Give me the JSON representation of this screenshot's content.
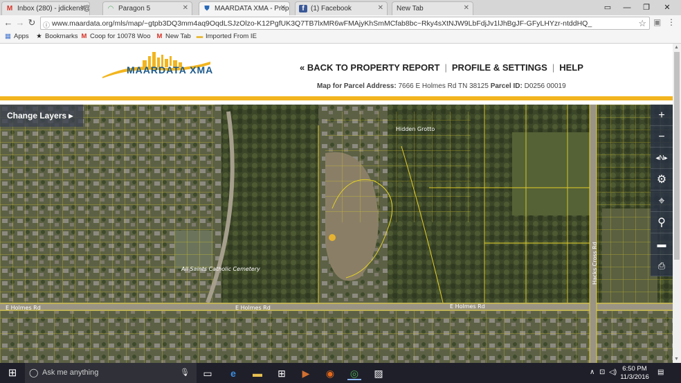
{
  "browser": {
    "tabs": [
      {
        "title": "Inbox (280) - jdickens@",
        "icon": "gmail-icon",
        "active": false
      },
      {
        "title": "Paragon 5",
        "icon": "paragon-icon",
        "active": false
      },
      {
        "title": "MAARDATA XMA - Prope",
        "icon": "shield-icon",
        "active": true
      },
      {
        "title": "(1) Facebook",
        "icon": "facebook-icon",
        "active": false
      },
      {
        "title": "New Tab",
        "icon": "",
        "active": false
      }
    ],
    "url": "www.maardata.org/mls/map/~gtpb3DQ3mm4aq9OqdLSJzOlzo-K12PgfUK3Q7TB7lxMR6wFMAjyKhSmMCfab8bc~Rky4sXtNJW9LbFdjJv1lJhBgJF-GFyLHYzr-ntddHQ_",
    "bookmarks": [
      {
        "label": "Apps",
        "icon": "apps-grid-icon"
      },
      {
        "label": "Bookmarks",
        "icon": "star-icon"
      },
      {
        "label": "Coop for 10078 Woo",
        "icon": "gmail-icon"
      },
      {
        "label": "New Tab",
        "icon": "gmail-icon"
      },
      {
        "label": "Imported From IE",
        "icon": "folder-icon"
      }
    ]
  },
  "site": {
    "logo_text": "MAARDATA XMA",
    "nav": {
      "back": "« BACK TO PROPERTY REPORT",
      "profile": "PROFILE & SETTINGS",
      "help": "HELP"
    },
    "parcel": {
      "label": "Map for Parcel Address:",
      "address": "7666 E Holmes Rd TN 38125",
      "id_label": "Parcel ID:",
      "id": "D0256   00019"
    }
  },
  "map": {
    "change_layers": "Change Layers",
    "street_labels": [
      "E Holmes Rd",
      "E Holmes Rd",
      "E Holmes Rd",
      "Hacks Cross Rd",
      "Hidden Grotto",
      "All Saints Catholic Cemetery"
    ],
    "tools": [
      "zoom-in-icon",
      "zoom-out-icon",
      "compass-icon",
      "settings-icon",
      "location-pin-icon",
      "search-icon",
      "ruler-icon",
      "print-icon"
    ]
  },
  "taskbar": {
    "search_placeholder": "Ask me anything",
    "time": "6:50 PM",
    "date": "11/3/2016"
  }
}
